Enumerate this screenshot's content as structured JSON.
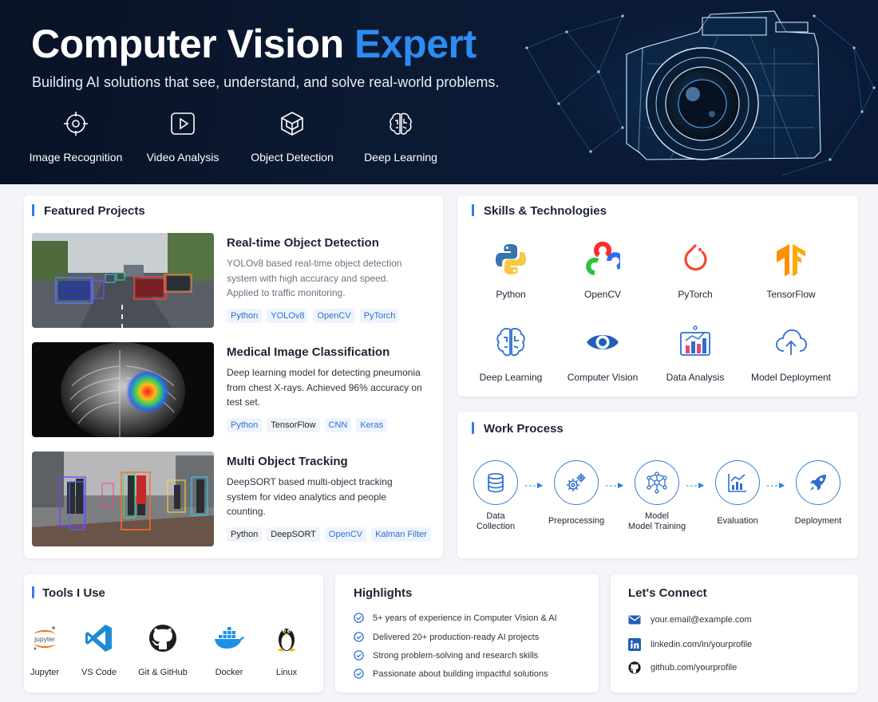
{
  "hero": {
    "title_main": "Computer Vision ",
    "title_accent": "Expert",
    "subtitle": "Building AI solutions that see, understand, and solve real-world problems.",
    "focus_areas": [
      {
        "label": "Image Recognition",
        "icon": "target-icon"
      },
      {
        "label": "Video Analysis",
        "icon": "video-play-icon"
      },
      {
        "label": "Object Detection",
        "icon": "cube-icon"
      },
      {
        "label": "Deep Learning",
        "icon": "brain-icon"
      }
    ]
  },
  "projects": {
    "title": "Featured Projects",
    "items": [
      {
        "title": "Real-time Object Detection",
        "description": "YOLOv8 based real-time object detection system with high accuracy and speed. Applied to traffic monitoring.",
        "tags": [
          "Python",
          "YOLOv8",
          "OpenCV",
          "PyTorch"
        ]
      },
      {
        "title": "Medical Image Classification",
        "description": "Deep learning model for detecting pneumonia from chest X-rays. Achieved 96% accuracy on test set.",
        "tags": [
          "Python",
          "TensorFlow",
          "CNN",
          "Keras"
        ]
      },
      {
        "title": "Multi Object Tracking",
        "description": "DeepSORT based multi-object tracking system for video analytics and people counting.",
        "tags": [
          "Python",
          "DeepSORT",
          "OpenCV",
          "Kalman Filter"
        ]
      }
    ]
  },
  "skills": {
    "title": "Skills & Technologies",
    "items": [
      {
        "label": "Python",
        "icon": "python-icon"
      },
      {
        "label": "OpenCV",
        "icon": "opencv-icon"
      },
      {
        "label": "PyTorch",
        "icon": "pytorch-icon"
      },
      {
        "label": "TensorFlow",
        "icon": "tensorflow-icon"
      },
      {
        "label": "Deep Learning",
        "icon": "brain-icon"
      },
      {
        "label": "Computer Vision",
        "icon": "eye-icon"
      },
      {
        "label": "Data Analysis",
        "icon": "bar-chart-icon"
      },
      {
        "label": "Model Deployment",
        "icon": "cloud-upload-icon"
      }
    ]
  },
  "process": {
    "title": "Work Process",
    "steps": [
      {
        "label": "Data\nCollection",
        "icon": "database-icon"
      },
      {
        "label": "Preprocessing",
        "icon": "gears-icon"
      },
      {
        "label": "Model\nModel Training",
        "icon": "neural-network-icon"
      },
      {
        "label": "Evaluation",
        "icon": "chart-icon"
      },
      {
        "label": "Deployment",
        "icon": "rocket-icon"
      }
    ]
  },
  "tools": {
    "title": "Tools I Use",
    "items": [
      {
        "label": "Jupyter",
        "icon": "jupyter-icon"
      },
      {
        "label": "VS Code",
        "icon": "vscode-icon"
      },
      {
        "label": "Git & GitHub",
        "icon": "github-icon"
      },
      {
        "label": "Docker",
        "icon": "docker-icon"
      },
      {
        "label": "Linux",
        "icon": "linux-icon"
      }
    ]
  },
  "highlights": {
    "title": "Highlights",
    "items": [
      "5+ years of experience in Computer Vision & AI",
      "Delivered 20+ production-ready AI projects",
      "Strong problem-solving and research skills",
      "Passionate about building impactful solutions"
    ]
  },
  "connect": {
    "title": "Let's Connect",
    "email": "your.email@example.com",
    "linkedin": "linkedin.com/in/yourprofile",
    "github": "github.com/yourprofile"
  },
  "colors": {
    "accent": "#2e8cf0",
    "hero_bg": "#0b1a33",
    "tag_text": "#2f6fd0"
  }
}
